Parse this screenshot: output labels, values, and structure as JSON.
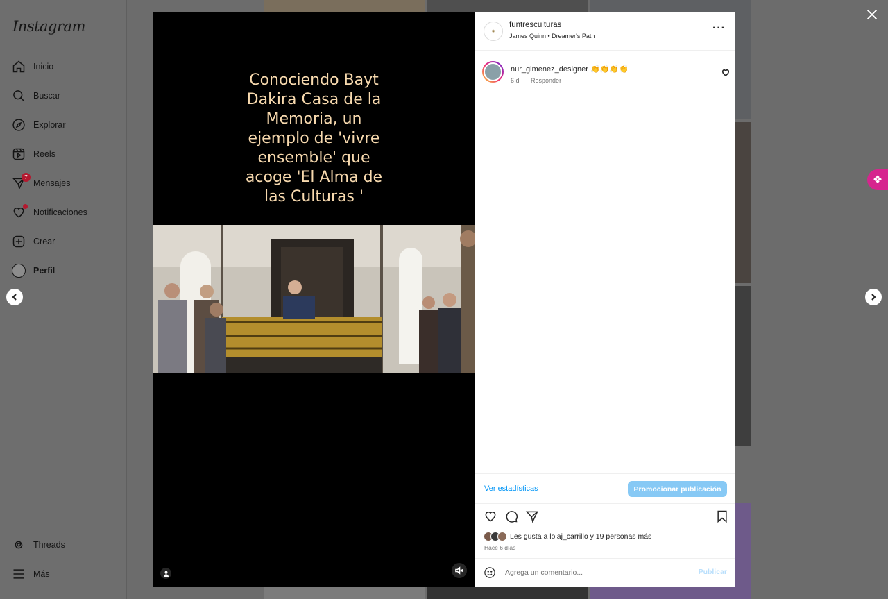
{
  "app": {
    "logo": "Instagram"
  },
  "sidebar": {
    "items": [
      {
        "label": "Inicio",
        "icon": "home-icon"
      },
      {
        "label": "Buscar",
        "icon": "search-icon"
      },
      {
        "label": "Explorar",
        "icon": "compass-icon"
      },
      {
        "label": "Reels",
        "icon": "reels-icon"
      },
      {
        "label": "Mensajes",
        "icon": "send-icon",
        "badge": "7"
      },
      {
        "label": "Notificaciones",
        "icon": "heart-icon"
      },
      {
        "label": "Crear",
        "icon": "plus-square-icon"
      },
      {
        "label": "Perfil",
        "icon": "avatar"
      }
    ],
    "bottom": [
      {
        "label": "Threads",
        "icon": "threads-icon"
      },
      {
        "label": "Más",
        "icon": "menu-icon"
      }
    ]
  },
  "post": {
    "media_text": "Conociendo Bayt\nDakira Casa de la\nMemoria, un\nejemplo de 'vivre\nensemble' que\nacoge 'El Alma de\nlas Culturas '",
    "author": {
      "username": "funtresculturas",
      "subtitle": "James Quinn • Dreamer's Path"
    },
    "comments": [
      {
        "username": "nur_gimenez_designer",
        "text": "👏👏👏👏",
        "age": "6 d",
        "reply_label": "Responder"
      }
    ],
    "stats_link": "Ver estadísticas",
    "promote_button": "Promocionar publicación",
    "likes": {
      "prefix": "Les gusta a",
      "user": "lolaj_carrillo",
      "middle": "y",
      "others": "19 personas más"
    },
    "time_ago": "Hace 6 días",
    "comment_placeholder": "Agrega un comentario...",
    "publish_label": "Publicar"
  },
  "colors": {
    "accent_blue": "#0095f6",
    "promote_blue": "#87c9f5",
    "notification_red": "#b3192f",
    "extension_pink": "#d6258e",
    "media_text": "#f7d9ae"
  }
}
